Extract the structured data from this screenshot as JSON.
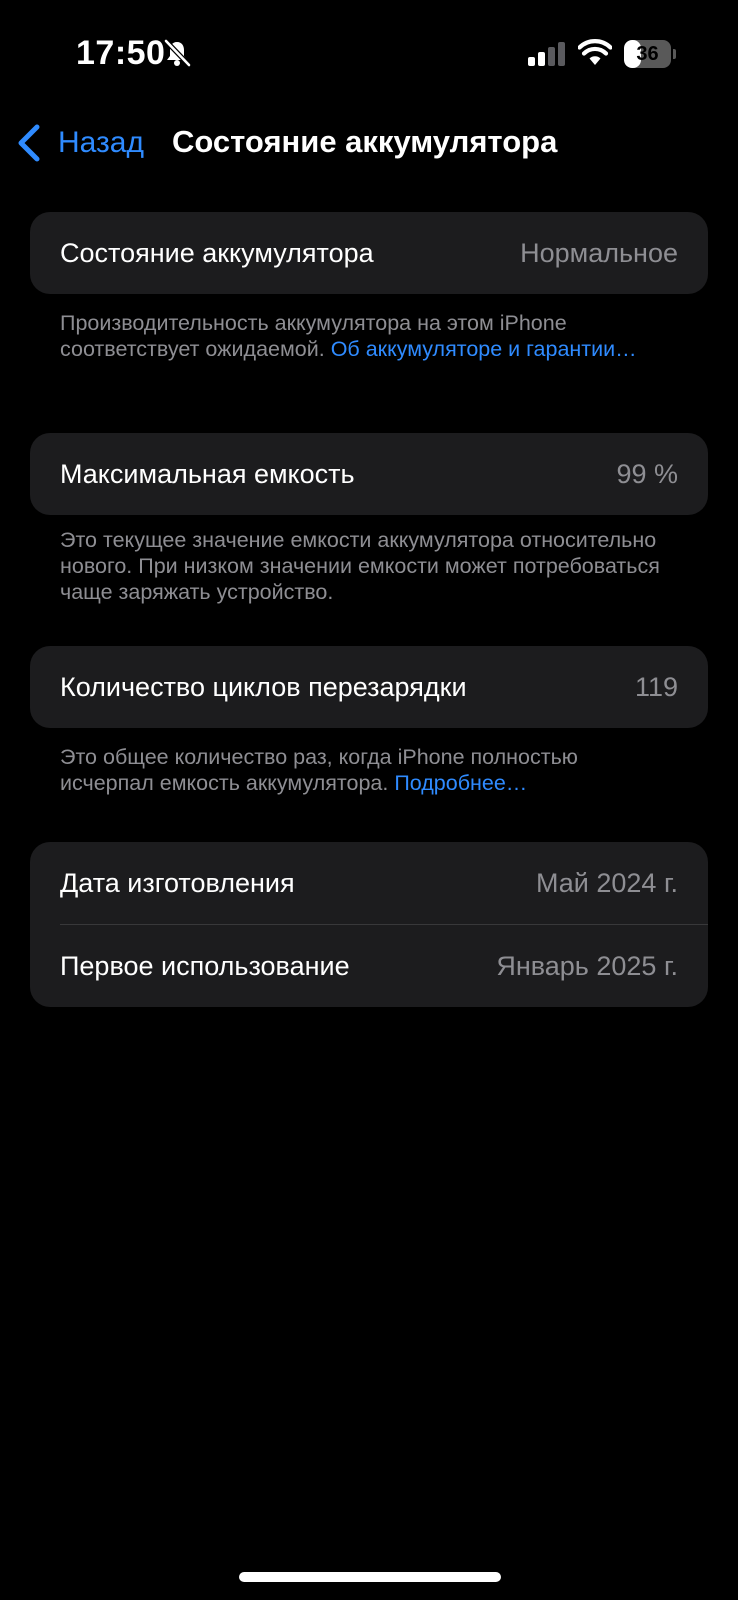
{
  "status_bar": {
    "time": "17:50",
    "battery_level": "36",
    "battery_fraction": 0.36,
    "icons": [
      "bell-slash-icon",
      "cellular-signal-icon",
      "wifi-icon",
      "battery-icon"
    ]
  },
  "nav": {
    "back_label": "Назад",
    "title": "Состояние аккумулятора"
  },
  "colors": {
    "background": "#000000",
    "cell_background": "#1c1c1e",
    "link": "#2f8bff",
    "secondary_text": "#8e8e93"
  },
  "battery_health": {
    "label": "Состояние аккумулятора",
    "value": "Нормальное",
    "footer_text": "Производительность аккумулятора на этом iPhone соответствует ожидаемой. ",
    "footer_link": "Об аккумуляторе и гарантии…"
  },
  "max_capacity": {
    "label": "Максимальная емкость",
    "value": "99 %",
    "footer_text": "Это текущее значение емкости аккумулятора относительно нового. При низком значении емкости может потребоваться чаще заряжать устройство."
  },
  "cycle_count": {
    "label": "Количество циклов перезарядки",
    "value": "119",
    "footer_text": "Это общее количество раз, когда iPhone полностью исчерпал емкость аккумулятора. ",
    "footer_link": "Подробнее…"
  },
  "dates": {
    "manufacture_label": "Дата изготовления",
    "manufacture_value": "Май 2024 г.",
    "first_use_label": "Первое использование",
    "first_use_value": "Январь 2025 г."
  }
}
